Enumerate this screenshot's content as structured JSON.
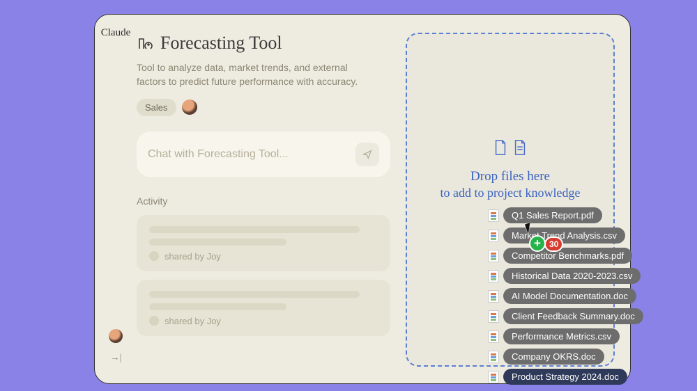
{
  "brand": "Claude",
  "page": {
    "title": "Forecasting Tool",
    "description": "Tool to analyze data, market trends, and external factors to predict future performance with accuracy.",
    "tag": "Sales"
  },
  "chat": {
    "placeholder": "Chat with Forecasting Tool..."
  },
  "activity": {
    "label": "Activity",
    "items": [
      {
        "shared_by": "shared by Joy"
      },
      {
        "shared_by": "shared by Joy"
      }
    ]
  },
  "dropzone": {
    "line1": "Drop files here",
    "line2": "to add to project knowledge"
  },
  "drag": {
    "count": "30",
    "files": [
      "Q1 Sales Report.pdf",
      "Market Trend Analysis.csv",
      "Competitor Benchmarks.pdf",
      "Historical Data 2020-2023.csv",
      "AI Model Documentation.doc",
      "Client Feedback Summary.doc",
      "Performance Metrics.csv",
      "Company OKRS.doc",
      "Product Strategy 2024.doc"
    ]
  }
}
